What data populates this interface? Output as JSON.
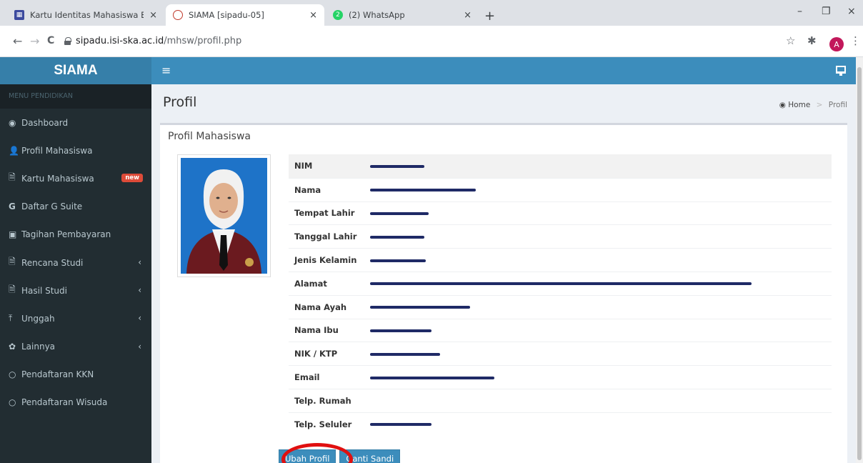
{
  "browser": {
    "tabs": [
      {
        "title": "Kartu Identitas Mahasiswa Elektr",
        "close": "×"
      },
      {
        "title": "SIAMA [sipadu-05]",
        "close": "×"
      },
      {
        "title": "(2) WhatsApp",
        "close": "×"
      }
    ],
    "whatsapp_count": "2",
    "new_tab": "+",
    "window": {
      "minimize": "–",
      "maximize": "❐",
      "close": "×"
    },
    "nav": {
      "back": "←",
      "forward": "→",
      "reload": "C"
    },
    "url_host": "sipadu.isi-ska.ac.id",
    "url_path": "/mhsw/profil.php",
    "star": "☆",
    "extensions": "✱",
    "profile_initial": "A",
    "menu": "⋮"
  },
  "app": {
    "brand": "SIAMA",
    "burger": "≡"
  },
  "sidebar": {
    "header": "MENU PENDIDIKAN",
    "items": [
      {
        "label": "Dashboard",
        "icon": "dashboard-icon",
        "glyph": "◉"
      },
      {
        "label": "Profil Mahasiswa",
        "icon": "user-icon",
        "glyph": "👤"
      },
      {
        "label": "Kartu Mahasiswa",
        "icon": "id-card-icon",
        "glyph": "🗎",
        "badge": "new"
      },
      {
        "label": "Daftar G Suite",
        "icon": "google-icon",
        "glyph": "G"
      },
      {
        "label": "Tagihan Pembayaran",
        "icon": "money-icon",
        "glyph": "▣"
      },
      {
        "label": "Rencana Studi",
        "icon": "file-icon",
        "glyph": "🗎",
        "chevron": "‹"
      },
      {
        "label": "Hasil Studi",
        "icon": "file-icon",
        "glyph": "🗎",
        "chevron": "‹"
      },
      {
        "label": "Unggah",
        "icon": "upload-icon",
        "glyph": "⤒",
        "chevron": "‹"
      },
      {
        "label": "Lainnya",
        "icon": "gear-icon",
        "glyph": "✿",
        "chevron": "‹"
      },
      {
        "label": "Pendaftaran KKN",
        "icon": "circle-icon",
        "glyph": "○"
      },
      {
        "label": "Pendaftaran Wisuda",
        "icon": "circle-icon",
        "glyph": "○"
      }
    ]
  },
  "page": {
    "title": "Profil",
    "breadcrumb_home": "Home",
    "breadcrumb_sep": ">",
    "breadcrumb_current": "Profil",
    "box_title": "Profil Mahasiswa"
  },
  "profile": {
    "rows": [
      {
        "label": "NIM"
      },
      {
        "label": "Nama"
      },
      {
        "label": "Tempat Lahir"
      },
      {
        "label": "Tanggal Lahir"
      },
      {
        "label": "Jenis Kelamin"
      },
      {
        "label": "Alamat"
      },
      {
        "label": "Nama Ayah"
      },
      {
        "label": "Nama Ibu"
      },
      {
        "label": "NIK / KTP"
      },
      {
        "label": "Email"
      },
      {
        "label": "Telp. Rumah"
      },
      {
        "label": "Telp. Seluler"
      }
    ]
  },
  "actions": {
    "edit_profile": "Ubah Profil",
    "change_password": "Ganti Sandi"
  },
  "colors": {
    "header_blue": "#3c8dbc",
    "logo_blue": "#367fa9",
    "sidebar_bg": "#222d32",
    "badge_red": "#dd4b39",
    "highlight_circle": "#e01010"
  }
}
